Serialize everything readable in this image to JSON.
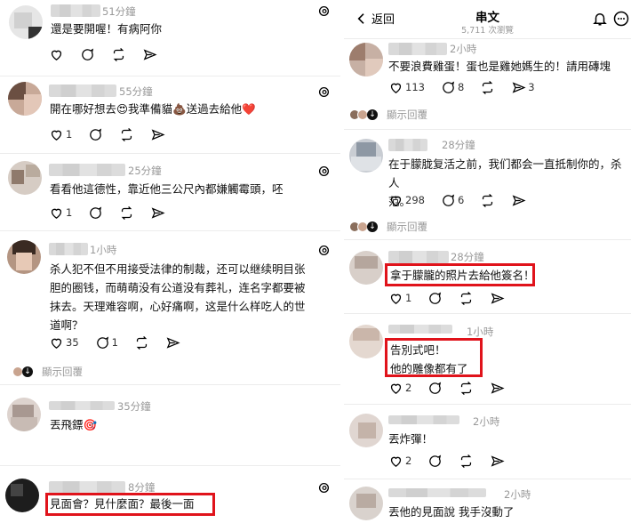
{
  "left": {
    "posts": [
      {
        "time": "51分鐘",
        "text": "還是要開喔！有病阿你",
        "likes": "",
        "comments": "",
        "reposts": ""
      },
      {
        "time": "55分鐘",
        "text": "開在哪好想去😍我準備貓💩送過去給他❤️",
        "likes": "1",
        "comments": "",
        "reposts": ""
      },
      {
        "time": "25分鐘",
        "text": "看看他這德性，靠近他三公尺內都嫌觸霉頭，呸",
        "likes": "1",
        "comments": "",
        "reposts": ""
      },
      {
        "time": "1小時",
        "text": "杀人犯不但不用接受法律的制裁，还可以继续明目张\n胆的圈钱，而萌萌没有公道没有葬礼，连名字都要被\n抹去。天理难容啊，心好痛啊，这是什么样吃人的世\n道啊？",
        "likes": "35",
        "comments": "1",
        "reposts": "",
        "show_replies": "顯示回覆"
      },
      {
        "time": "35分鐘",
        "text": "丟飛鏢🎯",
        "likes": "",
        "comments": "",
        "reposts": ""
      },
      {
        "time": "8分鐘",
        "text": "見面會？見什麼面？最後一面"
      }
    ]
  },
  "right": {
    "header": {
      "back_label": "返回",
      "title": "串文",
      "views": "5,711 次瀏覽"
    },
    "posts": [
      {
        "time": "2小時",
        "text": "不要浪費雞蛋！蛋也是雞她媽生的！請用磚塊",
        "likes": "113",
        "comments": "8",
        "reposts": "",
        "shares": "3",
        "show_replies": "顯示回覆"
      },
      {
        "time": "28分鐘",
        "text": "在于朦胧复活之前，我们都会一直抵制你的，杀人\n范。",
        "likes": "298",
        "comments": "6",
        "reposts": "",
        "shares": "",
        "show_replies": "顯示回覆"
      },
      {
        "time": "28分鐘",
        "text": "拿于朦朧的照片去給他簽名！",
        "likes": "1",
        "comments": "",
        "reposts": ""
      },
      {
        "time": "1小時",
        "text": "告別式吧！\n他的雕像都有了",
        "likes": "2",
        "comments": "",
        "reposts": ""
      },
      {
        "time": "2小時",
        "text": "丟炸彈！",
        "likes": "2",
        "comments": "",
        "reposts": ""
      },
      {
        "time": "2小時",
        "text": "丟他的見面說 我手沒動了"
      }
    ]
  },
  "icons": [
    "heart-icon",
    "comment-icon",
    "repost-icon",
    "share-icon",
    "threads-icon",
    "bell-icon",
    "more-icon",
    "back-chevron-icon"
  ],
  "colors": {
    "highlight": "#e0131b",
    "muted": "#999999",
    "separator": "#ececec"
  }
}
